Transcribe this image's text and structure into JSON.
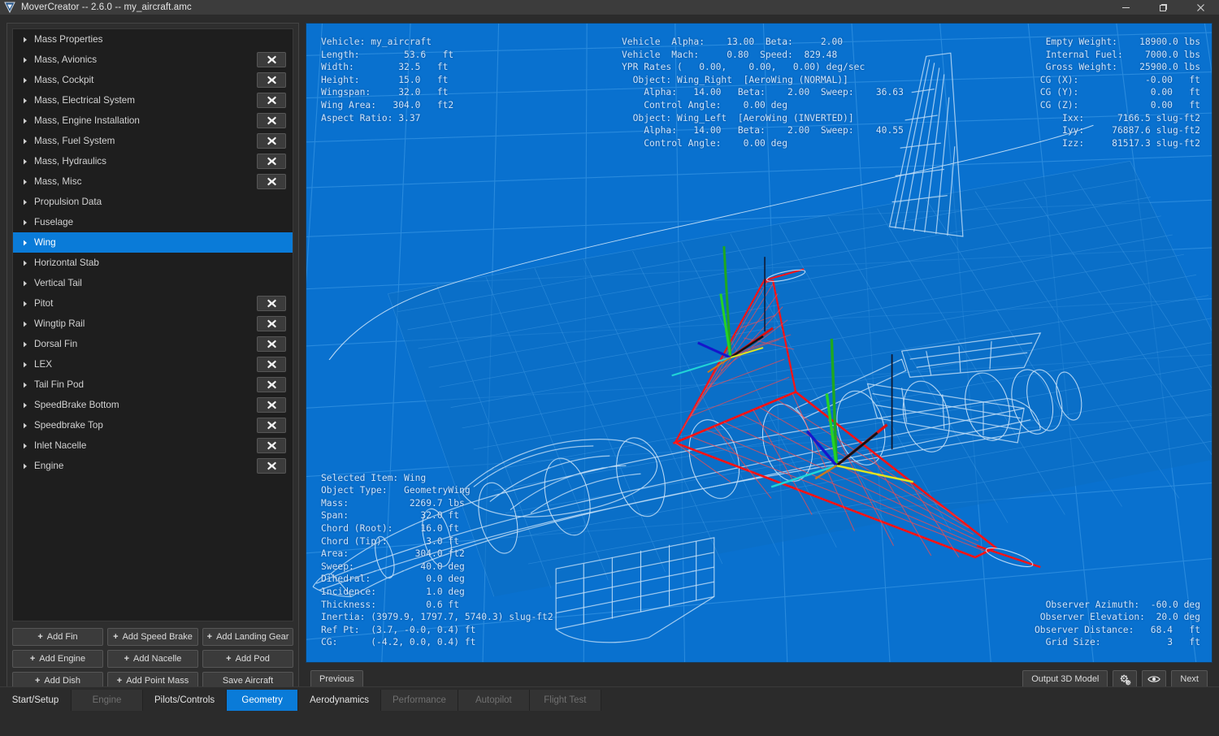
{
  "window": {
    "title": "MoverCreator -- 2.6.0 -- my_aircraft.amc",
    "logo_icon": "shield-logo-icon",
    "minimize_label": "minimize-icon",
    "maximize_label": "maximize-icon",
    "close_label": "close-icon"
  },
  "tree": {
    "items": [
      {
        "label": "Mass Properties",
        "deletable": false,
        "selected": false
      },
      {
        "label": "Mass, Avionics",
        "deletable": true,
        "selected": false
      },
      {
        "label": "Mass, Cockpit",
        "deletable": true,
        "selected": false
      },
      {
        "label": "Mass, Electrical System",
        "deletable": true,
        "selected": false
      },
      {
        "label": "Mass, Engine Installation",
        "deletable": true,
        "selected": false
      },
      {
        "label": "Mass, Fuel System",
        "deletable": true,
        "selected": false
      },
      {
        "label": "Mass, Hydraulics",
        "deletable": true,
        "selected": false
      },
      {
        "label": "Mass, Misc",
        "deletable": true,
        "selected": false
      },
      {
        "label": "Propulsion Data",
        "deletable": false,
        "selected": false
      },
      {
        "label": "Fuselage",
        "deletable": false,
        "selected": false
      },
      {
        "label": "Wing",
        "deletable": false,
        "selected": true
      },
      {
        "label": "Horizontal Stab",
        "deletable": false,
        "selected": false
      },
      {
        "label": "Vertical Tail",
        "deletable": false,
        "selected": false
      },
      {
        "label": "Pitot",
        "deletable": true,
        "selected": false
      },
      {
        "label": "Wingtip Rail",
        "deletable": true,
        "selected": false
      },
      {
        "label": "Dorsal Fin",
        "deletable": true,
        "selected": false
      },
      {
        "label": "LEX",
        "deletable": true,
        "selected": false
      },
      {
        "label": "Tail Fin Pod",
        "deletable": true,
        "selected": false
      },
      {
        "label": "SpeedBrake Bottom",
        "deletable": true,
        "selected": false
      },
      {
        "label": "Speedbrake Top",
        "deletable": true,
        "selected": false
      },
      {
        "label": "Inlet Nacelle",
        "deletable": true,
        "selected": false
      },
      {
        "label": "Engine",
        "deletable": true,
        "selected": false
      }
    ],
    "delete_icon": "delete-x-icon",
    "expand_icon": "chevron-right-icon"
  },
  "add_buttons": [
    {
      "label": "Add Fin",
      "plus": "+"
    },
    {
      "label": "Add Speed Brake",
      "plus": "+"
    },
    {
      "label": "Add Landing Gear",
      "plus": "+"
    },
    {
      "label": "Add Engine",
      "plus": "+"
    },
    {
      "label": "Add Nacelle",
      "plus": "+"
    },
    {
      "label": "Add Pod",
      "plus": "+"
    },
    {
      "label": "Add Dish",
      "plus": "+"
    },
    {
      "label": "Add Point Mass",
      "plus": "+"
    },
    {
      "label": "Save Aircraft",
      "plus": ""
    }
  ],
  "viewport": {
    "background_color": "#0971cf",
    "grid_color": "#2f8fe0",
    "wireframe_color": "#bfe0f8",
    "highlight_color": "#ff1111",
    "hud_top_left": "Vehicle: my_aircraft\nLength:        53.6   ft\nWidth:        32.5   ft\nHeight:       15.0   ft\nWingspan:     32.0   ft\nWing Area:   304.0   ft2\nAspect Ratio: 3.37",
    "hud_top_center": "Vehicle  Alpha:    13.00  Beta:     2.00\nVehicle  Mach:     0.80  Speed:  829.48\nYPR Rates (   0.00,    0.00,   0.00) deg/sec\n  Object: Wing_Right  [AeroWing (NORMAL)]\n    Alpha:   14.00   Beta:    2.00  Sweep:    36.63\n    Control Angle:    0.00 deg\n  Object: Wing_Left  [AeroWing (INVERTED)]\n    Alpha:   14.00   Beta:    2.00  Sweep:    40.55\n    Control Angle:    0.00 deg",
    "hud_top_right": "Empty Weight:    18900.0 lbs\nInternal Fuel:    7000.0 lbs\nGross Weight:    25900.0 lbs\nCG (X):            -0.00   ft\nCG (Y):             0.00   ft\nCG (Z):             0.00   ft\nIxx:      7166.5 slug-ft2\nIyy:     76887.6 slug-ft2\nIzz:     81517.3 slug-ft2",
    "hud_bottom_left": "Selected Item: Wing\nObject Type:   GeometryWing\nMass:           2269.7 lbs\nSpan:             32.0 ft\nChord (Root):     16.0 ft\nChord (Tip):       3.0 ft\nArea:            304.0 ft2\nSweep:            40.0 deg\nDihedral:          0.0 deg\nIncidence:         1.0 deg\nThickness:         0.6 ft\nInertia: (3979.9, 1797.7, 5740.3) slug-ft2\nRef Pt:  (3.7, -0.0, 0.4) ft\nCG:      (-4.2, 0.0, 0.4) ft",
    "hud_bottom_right": "Observer Azimuth:  -60.0 deg\nObserver Elevation:  20.0 deg\nObserver Distance:   68.4   ft\nGrid Size:            3   ft"
  },
  "viewport_toolbar": {
    "previous_label": "Previous",
    "output_3d_label": "Output 3D Model",
    "settings_icon": "gears-icon",
    "visibility_icon": "eye-icon",
    "next_label": "Next"
  },
  "tabs": [
    {
      "label": "Start/Setup",
      "state": "enabled"
    },
    {
      "label": "Engine",
      "state": "disabled"
    },
    {
      "label": "Pilots/Controls",
      "state": "enabled"
    },
    {
      "label": "Geometry",
      "state": "active"
    },
    {
      "label": "Aerodynamics",
      "state": "enabled"
    },
    {
      "label": "Performance",
      "state": "disabled"
    },
    {
      "label": "Autopilot",
      "state": "disabled"
    },
    {
      "label": "Flight Test",
      "state": "disabled"
    }
  ]
}
